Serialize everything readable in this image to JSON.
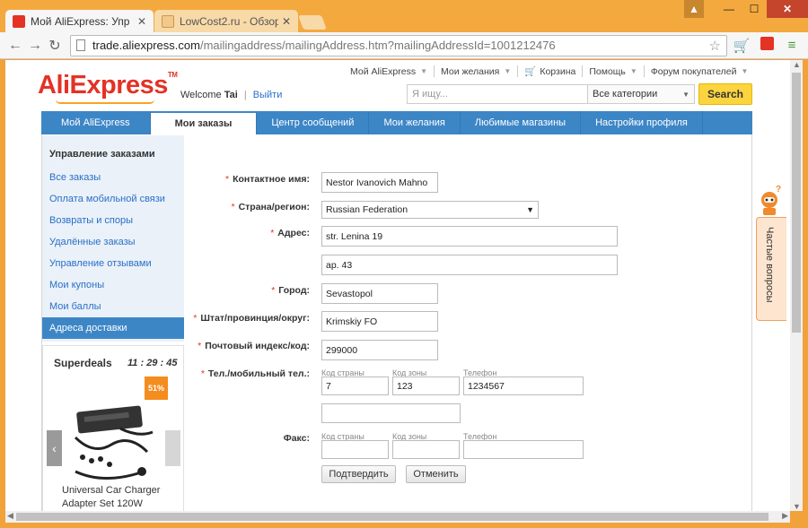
{
  "browser": {
    "tabs": [
      {
        "title": "Мой AliExpress: Упр",
        "active": true
      },
      {
        "title": "LowCost2.ru - Обзор",
        "active": false
      }
    ],
    "url_host": "trade.aliexpress.com",
    "url_path": "/mailingaddress/mailingAddress.htm?mailingAddressId=1001212476"
  },
  "header": {
    "logo": "AliExpress",
    "welcome_label": "Welcome",
    "user_name": "Tai",
    "logout": "Выйти",
    "topnav": {
      "my_aliexpress": "Мой AliExpress",
      "wishlist": "Мои желания",
      "cart": "Корзина",
      "help": "Помощь",
      "forum": "Форум покупателей"
    },
    "search": {
      "placeholder": "Я ищу...",
      "category": "Все категории",
      "button": "Search"
    }
  },
  "mainnav": [
    "Мой AliExpress",
    "Мои заказы",
    "Центр сообщений",
    "Мои желания",
    "Любимые магазины",
    "Настройки профиля"
  ],
  "sidebar": {
    "heading": "Управление заказами",
    "items": [
      "Все заказы",
      "Оплата мобильной связи",
      "Возвраты и споры",
      "Удалённые заказы",
      "Управление отзывами",
      "Мои купоны",
      "Мои баллы",
      "Адреса доставки"
    ]
  },
  "deals": {
    "title": "Superdeals",
    "timer": "11 : 29 : 45",
    "discount": "51%",
    "product_name": "Universal Car Charger Adapter Set 120W"
  },
  "form": {
    "contact_label": "Контактное имя:",
    "contact_value": "Nestor Ivanovich Mahno",
    "country_label": "Страна/регион:",
    "country_value": "Russian Federation",
    "address_label": "Адрес:",
    "address1_value": "str. Lenina 19",
    "address2_value": "ap. 43",
    "city_label": "Город:",
    "city_value": "Sevastopol",
    "state_label": "Штат/провинция/округ:",
    "state_value": "Krimskiy FO",
    "zip_label": "Почтовый индекс/код:",
    "zip_value": "299000",
    "phone_label": "Тел./мобильный тел.:",
    "country_code_label": "Код страны",
    "area_code_label": "Код зоны",
    "phone_number_label": "Телефон",
    "country_code_value": "7",
    "area_code_value": "123",
    "phone_value": "1234567",
    "fax_label": "Факс:",
    "confirm_button": "Подтвердить",
    "cancel_button": "Отменить"
  },
  "faq": {
    "label": "Частые вопросы"
  },
  "colors": {
    "brand_red": "#e43225",
    "nav_blue": "#3d86c6",
    "chrome_orange": "#f4a93f",
    "search_yellow": "#fcd440"
  }
}
